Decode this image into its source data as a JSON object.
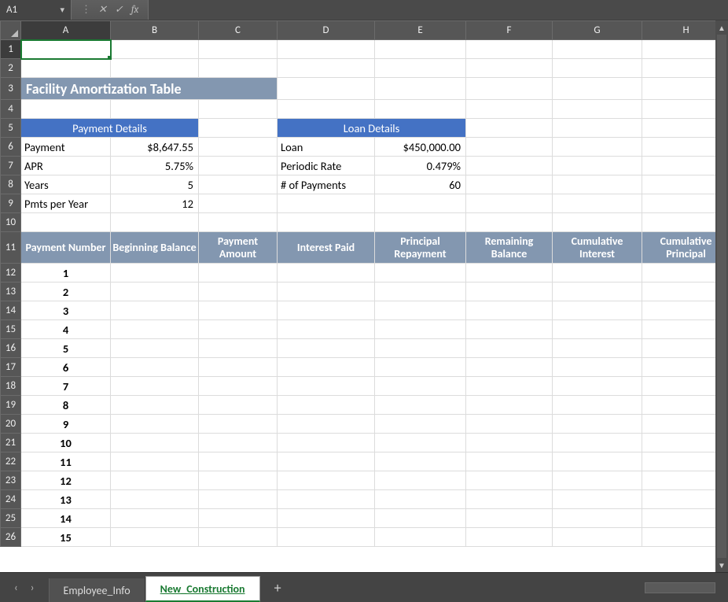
{
  "name_box": "A1",
  "fx_symbols": {
    "dots": "⋮",
    "x": "✕",
    "check": "✓",
    "fx": "fx"
  },
  "formula_value": "",
  "columns": [
    "A",
    "B",
    "C",
    "D",
    "E",
    "F",
    "G",
    "H"
  ],
  "row_count": 26,
  "title": "Facility Amortization Table",
  "payment_details": {
    "header": "Payment Details",
    "rows": [
      {
        "label": "Payment",
        "value": "$8,647.55"
      },
      {
        "label": "APR",
        "value": "5.75%"
      },
      {
        "label": "Years",
        "value": "5"
      },
      {
        "label": "Pmts per Year",
        "value": "12"
      }
    ]
  },
  "loan_details": {
    "header": "Loan Details",
    "rows": [
      {
        "label": "Loan",
        "value": "$450,000.00"
      },
      {
        "label": "Periodic Rate",
        "value": "0.479%"
      },
      {
        "label": "# of Payments",
        "value": "60"
      }
    ]
  },
  "table_headers": [
    "Payment Number",
    "Beginning Balance",
    "Payment Amount",
    "Interest Paid",
    "Principal Repayment",
    "Remaining Balance",
    "Cumulative Interest",
    "Cumulative Principal"
  ],
  "payment_numbers": [
    1,
    2,
    3,
    4,
    5,
    6,
    7,
    8,
    9,
    10,
    11,
    12,
    13,
    14,
    15
  ],
  "tabs": {
    "list": [
      "Employee_Info",
      "New_Construction"
    ],
    "active_index": 1,
    "add_glyph": "+"
  },
  "nav": {
    "prev": "‹",
    "next": "›"
  }
}
